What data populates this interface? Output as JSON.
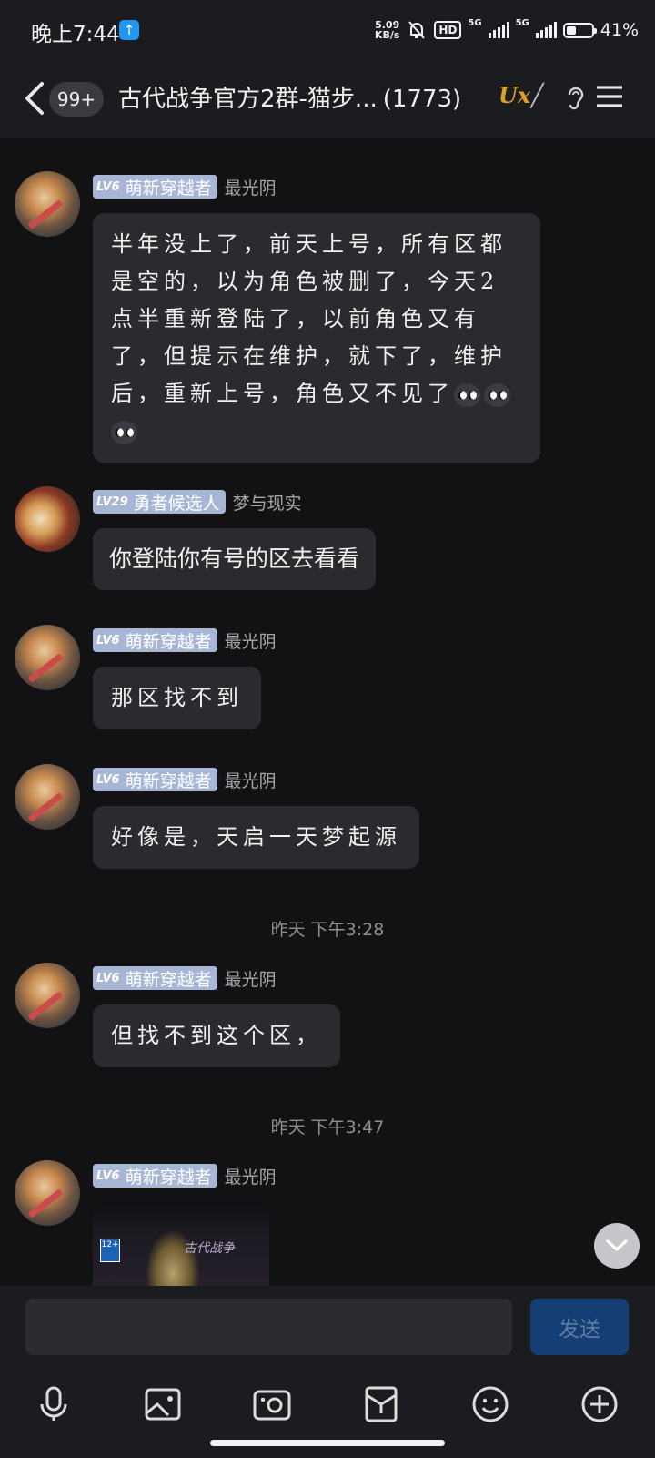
{
  "status_bar": {
    "time": "晚上7:44",
    "speed_value": "5.09",
    "speed_unit": "KB/s",
    "hd": "HD",
    "net1": "5G",
    "net2": "5G",
    "battery": "41%",
    "battery_level": 0.41
  },
  "header": {
    "unread_badge": "99+",
    "title": "古代战争官方2群-猫步...",
    "member_count": "(1773)",
    "logo_text": "Ux"
  },
  "messages": [
    {
      "level": "LV6",
      "badge": "萌新穿越者",
      "nick": "最光阴",
      "text": "半年没上了，前天上号，所有区都是空的，以为角色被删了，今天2点半重新登陆了，以前角色又有了，但提示在维护，就下了，维护后，重新上号，角色又不见了"
    },
    {
      "level": "LV29",
      "badge": "勇者候选人",
      "nick": "梦与现实",
      "text": "你登陆你有号的区去看看"
    },
    {
      "level": "LV6",
      "badge": "萌新穿越者",
      "nick": "最光阴",
      "text": "那区找不到"
    },
    {
      "level": "LV6",
      "badge": "萌新穿越者",
      "nick": "最光阴",
      "text": "好像是，天启一天梦起源"
    },
    {
      "level": "LV6",
      "badge": "萌新穿越者",
      "nick": "最光阴",
      "text": "但找不到这个区，"
    },
    {
      "level": "LV6",
      "badge": "萌新穿越者",
      "nick": "最光阴",
      "image_age": "12+",
      "image_title": "古代战争"
    }
  ],
  "timestamps": [
    "昨天 下午3:28",
    "昨天 下午3:47"
  ],
  "input": {
    "placeholder": "",
    "send_label": "发送"
  },
  "toolbar_icons": [
    "microphone-icon",
    "image-icon",
    "camera-icon",
    "wallet-icon",
    "emoji-icon",
    "plus-icon"
  ]
}
